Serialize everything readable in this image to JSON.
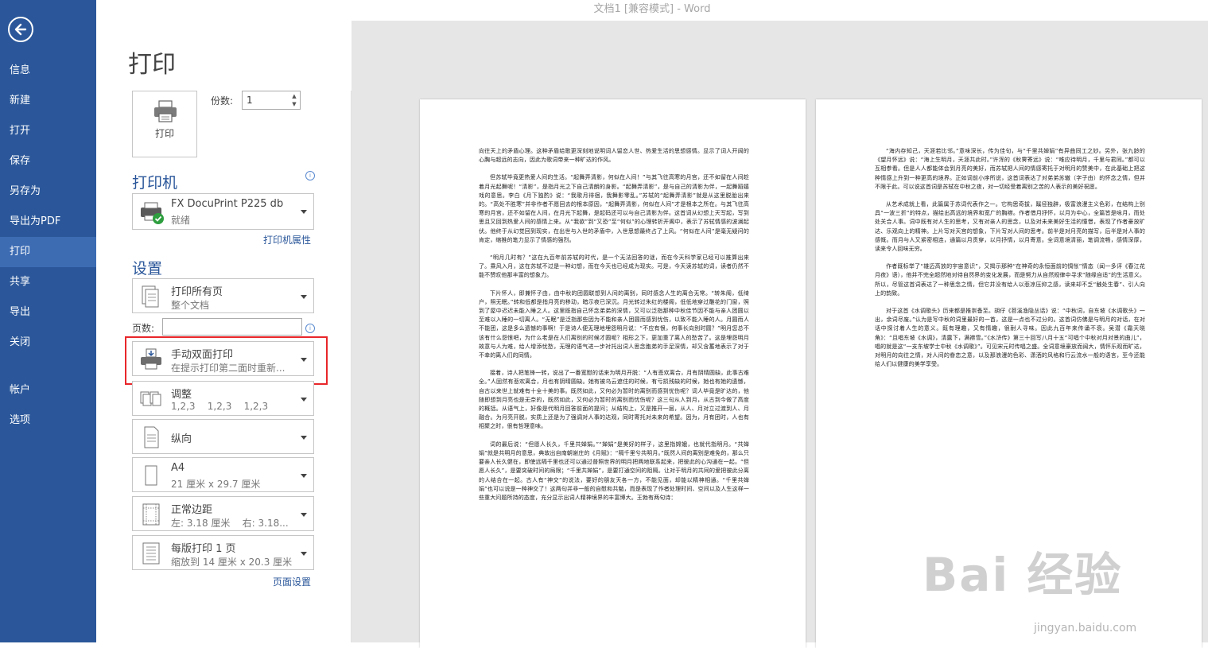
{
  "window": {
    "title": "文档1 [兼容模式] - Word"
  },
  "nav": {
    "items": [
      {
        "label": "信息"
      },
      {
        "label": "新建"
      },
      {
        "label": "打开"
      },
      {
        "label": "保存"
      },
      {
        "label": "另存为"
      },
      {
        "label": "导出为PDF"
      },
      {
        "label": "打印"
      },
      {
        "label": "共享"
      },
      {
        "label": "导出"
      },
      {
        "label": "关闭"
      },
      {
        "label": "帐户"
      },
      {
        "label": "选项"
      }
    ],
    "active": "打印"
  },
  "print": {
    "title": "打印",
    "button_label": "打印",
    "copies_label": "份数:",
    "copies_value": "1"
  },
  "printer": {
    "heading": "打印机",
    "name": "FX DocuPrint P225 db",
    "status": "就绪",
    "properties_link": "打印机属性"
  },
  "settings": {
    "heading": "设置",
    "pages_label": "页数:",
    "pages_value": "",
    "page_setup_link": "页面设置",
    "options": [
      {
        "title": "打印所有页",
        "subtitle": "整个文档",
        "icon": "pages-icon"
      },
      {
        "title": "手动双面打印",
        "subtitle": "在提示打印第二面时重新...",
        "icon": "duplex-printer-icon"
      },
      {
        "title": "调整",
        "subtitle": "1,2,3    1,2,3    1,2,3",
        "icon": "collate-icon"
      },
      {
        "title": "纵向",
        "subtitle": "",
        "icon": "portrait-icon"
      },
      {
        "title": "A4",
        "subtitle": "21 厘米 x 29.7 厘米",
        "icon": "paper-size-icon"
      },
      {
        "title": "正常边距",
        "subtitle": "左: 3.18 厘米    右: 3.18...",
        "icon": "margins-icon"
      },
      {
        "title": "每版打印 1 页",
        "subtitle": "缩放到 14 厘米 x 20.3 厘米",
        "icon": "pages-per-sheet-icon"
      }
    ]
  },
  "preview": {
    "page1": [
      "向往天上的矛盾心理。这种矛盾给歌更深刻地说明词人留恋人世、热爱生活的思想感情。显示了词人开阔的心胸与超远的志向，因此为歌词带来一种旷达的作风。",
      "但苏轼毕竟更热爱人间的生活。“起舞弄清影，何似在人间！”与其飞往高寒的月宫，还不如留在人间趁着月光起舞呢！“清影”，是指月光之下自己清朗的身影。“起舞弄清影”，是与自己的清影为伴，一起舞蹈嬉戏的意思。李白《月下独酌》说：“我歌月徘徊，我舞影零乱。”苏轼的“起舞弄清影”就是从这里脱胎出来的。“高处不胜寒”并非作者不愿回去的根本原因，“起舞弄清影，何似在人间”才是根本之所在。与其飞往高寒的月宫，还不如留在人间，在月光下起舞，是起码还可以与自己清影为伴。这首词从幻想上天写起，写到思且又回到热爱人间的感情上来。从“我欲”到“又恐”至“何似”的心理转折开阖中，表示了苏轼情感的波澜起伏。他终于从幻觉回到现实，在出世与入世的矛盾中，入世思想最终占了上风。“何似在人间”是毫无疑问的肯定，缩推的笔力显示了情感的强烈。",
      "“明月几时有？”这在九百年前苏轼的时代，是一个无法回答的谜，而在今天科学家已经可以推算出来了。乘风入月，这在苏轼不过是一种幻想，而在今天也已经成为现实。可是，今天读苏轼的词，读者仍然不能不赞叹他那丰富的想象力。",
      "下片怀人，即兼怀子由，由中秋的团圆联想到人间的离别，同时感念人生的离合无常。“转朱阁，低绮户，照无眠。”转和低都是指月亮的移动，暗示夜已深沉。月光转过朱红的楼阁，低低地穿过雕花的门窗，照到了屋中迟迟未能入睡之人。这里既指自己怀念弟弟的深情，又可以泛指那种中秋佳节因不能与亲人团圆以至难以入睡的一切离人。“无眠”是泛指那些因为不能和亲人团圆而感到忧伤，以致不能入睡的人。月圆而人不能团，这是多么遗憾的事啊！于是诗人便无理地埋怨明月说：“不应有恨，何事长向别时圆？”明月您总不该有什么怨恨吧，为什么老是在人们离别的时候才圆呢？相形之下，更加重了离人的愁苦了。这是埋怨明月故意与人为难，给人增添忧愁，无理的语气进一步衬托出词人思念胞弟的手足深情，却又含蓄地表示了对于不幸的离人们的同情。",
      "接着，诗人把笔锋一转，说出了一番宽慰的话来为明月开脱：“人有悲欢离合，月有阴晴圆缺，此事古难全。”人固然有悲欢离合，月也有阴晴圆缺。她有被乌云遮住的时候，有亏损残缺的时候，她也有她的遗憾，自古以来世上就难有十全十美的事。既然如此，又何必为暂时的离别而感到忧伤呢？词人毕竟是旷达的，他随即想到月亮也是无奈的，既然如此，又何必为暂时的离别而忧伤呢？这三句从人到月，从古到今做了高度的概括。从语气上，好像是代明月回答前面的提问；从结构上，又是推开一层，从人、月对立过渡到人、月融合。为月亮开脱，实质上还是为了强调对人事的达观，同时寄托对未来的希望。因为，月有团时，人也有相聚之时，很有哲理意味。",
      "词的最后说：“但愿人长久，千里共婵娟。”“婵娟”是美好的样子，这里指嫦娥，也就代指明月。“共婵娟”就是共明月的意思，典故出自南朝谢庄的《月赋》：“隔千里兮共明月。”既然人间的离别是难免的，那么只要亲人长久健在，即使远隔千里也还可以通过普照世界的明月把两地联系起来，把彼此的心沟通在一起。“但愿人长久”，是要突破时间的局限；“千里共婵娟”，是要打通空间的阻隔。让对于明月的共同的爱把彼此分离的人结合在一起。古人有“神交”的说法，要好的朋友天各一方，不能见面，却能以精神相通。“千里共婵娟”也可以说是一种神交了！这两句并非一般的自慰和共勉，而是表现了作者处理时间、空间以及人生这样一些重大问题所持的态度，充分显示出词人精神境界的丰富博大。王勃有两句诗："
    ],
    "page2": [
      "“海内存知己，天涯若比邻。”意味深长，传为佳句，与“千里共婵娟”有异曲同工之妙。另外，张九龄的《望月怀远》说：“海上生明月，天涯共此时。”许浑的《秋霁寄远》说：“唯应待明月，千里与君同。”都可以互相参看。但是人人都能体会到月亮的美好，而苏轼把人间的情感寄托于对明月的赞美中，在此基础上把这种情感上升到一种更高的境界。正如词前小序所说，这首词表达了对弟弟苏辙（字子由）的怀念之情，但并不限于此。可以说这首词是苏轼在中秋之夜，对一切经受着离别之苦的人表示的美好祝愿。",
      "从艺术成就上看，此篇属于苏词代表作之一。它构思奇拔，蹊径独辟，极富浪漫主义色彩，在结构上别具“一波三折”的特点，描绘出高远的境界和宽广的胸襟。作者借月抒怀，以月为中心，全篇皆是咏月，而处处关合人事。词中既有对人生的思考，又有对亲人的思念，以及对未来美好生活的憧憬，表现了作者豪放旷达、乐观向上的精神。上片写对天宫的想象，下片写对人间的思考。前半是对月亮的描写，后半是对人事的感慨。而月与人又紧密相连，通篇以月贯穿，以月抒情，以月寄意。全词意境清丽，笔调流畅，感情深厚，读来令人回味无穷。",
      "作者既标举了“雄迈高放的宇宙意识”，又揭示那种“在神奇的永恒面前的惆怅”情态（闻一多评《春江花月夜》语），他并不完全超然地对待自然界的变化发展，而是努力从自然规律中寻求“随缘自适”的生活意义。所以，尽管这首词表达了一种思念之情，但它并没有给人以悲凉压抑之感，读来却不乏“触处生春”、引人向上的韵致。",
      "对于这首《水调歌头》历来都是推崇备至。胡仔《苕溪渔隐丛话》说：“中秋词，自东坡《水调歌头》一出，余词尽废。”认为是写中秋的词里最好的一首，这是一点也不过分的。这首词仿佛是与明月的对话，在对话中探讨着人生的意义。既有理趣，又有情趣，很耐人寻味。因此九百年来传诵不衰。吴潜《霜天晓角》：“且唱东坡《水调》，清露下，满襟雪。”《水浒传》第三十回写八月十五“可唱个中秋对月对景的曲儿”，唱的就是这“一支东坡学士中秋《水调歌》”。可见宋元时传唱之盛。全词意境豪放而阔大，情怀乐观而旷达，对明月的向往之情，对人间的眷恋之意，以及那浪漫的色彩、潇洒的风格和行云流水一般的语言，至今还能给人们以健康的美学享受。"
    ]
  },
  "watermark": {
    "text": "Bai 经验",
    "url": "jingyan.baidu.com"
  }
}
